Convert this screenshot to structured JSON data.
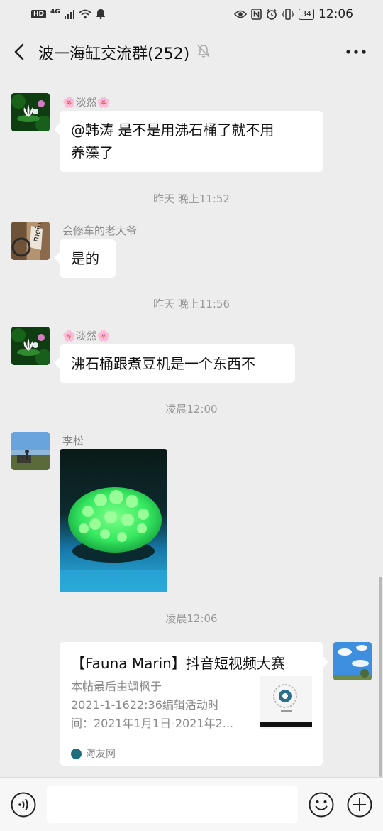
{
  "status_bar": {
    "left": [
      "HD",
      "4G"
    ],
    "time": "12:06",
    "battery": "34"
  },
  "header": {
    "title": "波一海缸交流群(252)"
  },
  "messages": [
    {
      "sender": "🌸淡然🌸",
      "text_line1": "@韩涛  是不是用沸石桶了就不用",
      "text_line2": "养藻了"
    },
    {
      "sender": "会修车的老大爷",
      "text": "是的"
    },
    {
      "sender": "🌸淡然🌸",
      "text": "沸石桶跟煮豆机是一个东西不"
    },
    {
      "sender": "李松"
    }
  ],
  "timestamps": [
    "昨天 晚上11:52",
    "昨天 晚上11:56",
    "凌晨12:00",
    "凌晨12:06"
  ],
  "link_card": {
    "title": "【Fauna Marin】抖音短视频大赛",
    "desc_lines": [
      "本帖最后由飒枫于",
      "2021-1-1622:36编辑活动时",
      "间：2021年1月1日-2021年2..."
    ],
    "source": "海友网"
  },
  "colors": {
    "background": "#ededed",
    "bubble": "#ffffff",
    "coral": "#35e860",
    "water": "#1e9ccc"
  }
}
